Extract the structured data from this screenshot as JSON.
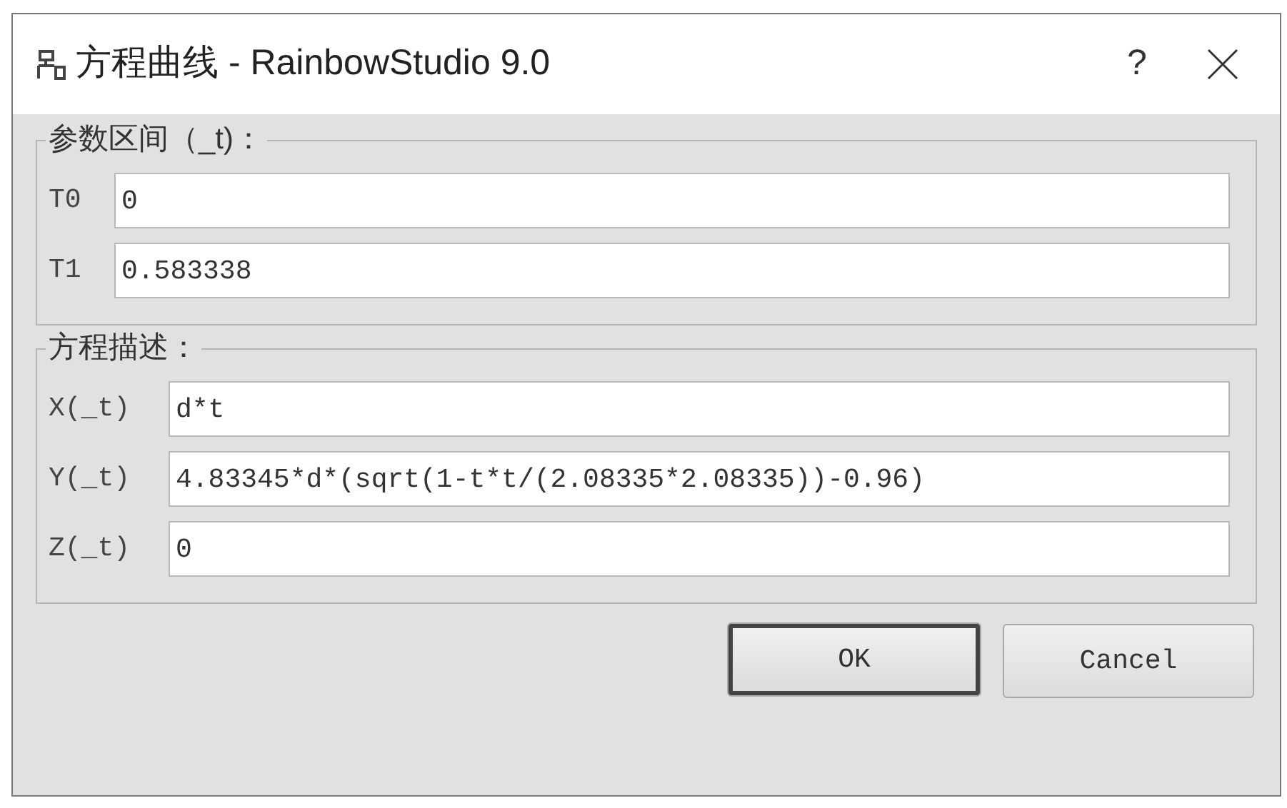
{
  "window": {
    "title": "方程曲线 - RainbowStudio 9.0",
    "help": "?"
  },
  "groups": [
    {
      "title": "参数区间（_t)：",
      "fields": [
        {
          "label": "T0",
          "value": "0"
        },
        {
          "label": "T1",
          "value": "0.583338"
        }
      ]
    },
    {
      "title": "方程描述：",
      "fields": [
        {
          "label": "X(_t)",
          "value": "d*t"
        },
        {
          "label": "Y(_t)",
          "value": "4.83345*d*(sqrt(1-t*t/(2.08335*2.08335))-0.96)"
        },
        {
          "label": "Z(_t)",
          "value": "0"
        }
      ]
    }
  ],
  "buttons": [
    {
      "label": "OK",
      "default": true
    },
    {
      "label": "Cancel",
      "default": false
    }
  ]
}
